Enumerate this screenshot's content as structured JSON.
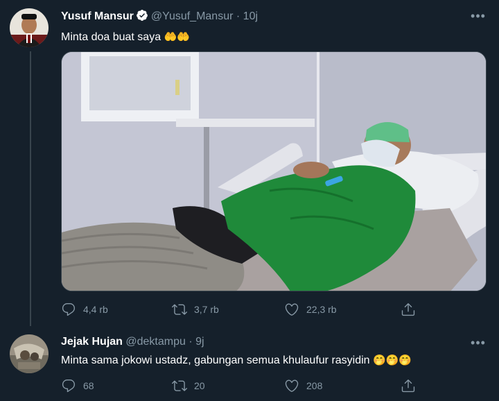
{
  "tweet1": {
    "name": "Yusuf Mansur",
    "handle": "@Yusuf_Mansur",
    "separator": "·",
    "time": "10j",
    "text": "Minta doa buat saya",
    "emoji": "🤲🤲",
    "replies": "4,4 rb",
    "retweets": "3,7 rb",
    "likes": "22,3 rb"
  },
  "tweet2": {
    "name": "Jejak Hujan",
    "handle": "@dektampu",
    "separator": "·",
    "time": "9j",
    "text": "Minta sama jokowi ustadz, gabungan semua khulaufur rasyidin",
    "emoji": "🤭🤭🤭",
    "replies": "68",
    "retweets": "20",
    "likes": "208"
  },
  "icons": [
    "verified-icon",
    "more-icon",
    "reply-icon",
    "retweet-icon",
    "like-icon",
    "share-icon"
  ],
  "colors": {
    "background": "#15202b",
    "muted": "#8899a6",
    "verified": "#ffffff",
    "divider": "#38444d"
  }
}
